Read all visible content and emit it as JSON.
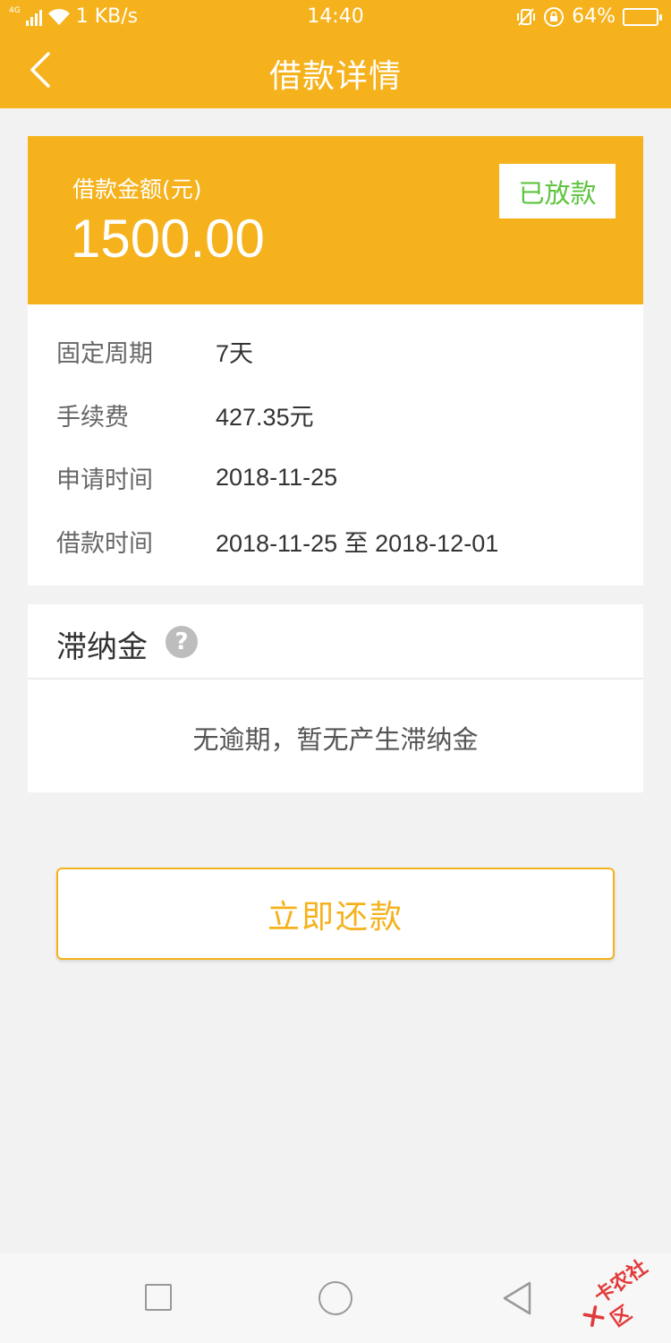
{
  "status_bar": {
    "network": "4G",
    "speed": "1 KB/s",
    "time": "14:40",
    "battery": "64%",
    "battery_level": 0.64
  },
  "header": {
    "title": "借款详情"
  },
  "loan": {
    "amount_label": "借款金额(元)",
    "amount": "1500.00",
    "status": "已放款",
    "details": [
      {
        "label": "固定周期",
        "value": "7天"
      },
      {
        "label": "手续费",
        "value": "427.35元"
      },
      {
        "label": "申请时间",
        "value": "2018-11-25"
      },
      {
        "label": "借款时间",
        "value": "2018-11-25 至 2018-12-01"
      }
    ]
  },
  "late_fee": {
    "title": "滞纳金",
    "help": "?",
    "message": "无逾期，暂无产生滞纳金"
  },
  "actions": {
    "repay": "立即还款"
  },
  "watermark": {
    "text": "卡农社区"
  },
  "colors": {
    "primary": "#f5b21c",
    "status_green": "#5ec43f"
  }
}
